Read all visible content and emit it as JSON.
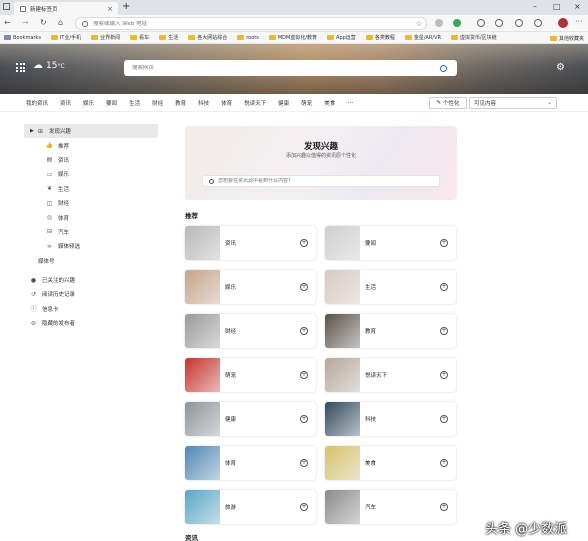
{
  "browser": {
    "tab_title": "新建标签页",
    "url_placeholder": "搜索或输入 Web 地址",
    "bookmarks": [
      "Bookmarks",
      "IT业/手机",
      "业界新闻",
      "看车",
      "生活",
      "各大网站综合",
      "roots",
      "MDM虚拟化/教育",
      "App运营",
      "各类教程",
      "金星/AR/VR",
      "虚拟货币/区块链"
    ],
    "other_bookmarks": "其他收藏夹"
  },
  "hero": {
    "temperature": "15",
    "unit": "°C",
    "search_placeholder": "搜索网页"
  },
  "categories": [
    "我的资讯",
    "资讯",
    "娱乐",
    "要闻",
    "生活",
    "财经",
    "教育",
    "科技",
    "体育",
    "悦读天下",
    "健康",
    "萌宠",
    "美食"
  ],
  "personalize_label": "个性化",
  "visibility_label": "可见内容",
  "sidebar": {
    "main_label": "发现兴趣",
    "sub_items": [
      {
        "label": "推荐",
        "icon": "thumbs-up-icon"
      },
      {
        "label": "资讯",
        "icon": "newspaper-icon"
      },
      {
        "label": "娱乐",
        "icon": "tv-icon"
      },
      {
        "label": "生活",
        "icon": "leaf-icon"
      },
      {
        "label": "财经",
        "icon": "money-icon"
      },
      {
        "label": "体育",
        "icon": "ball-icon"
      },
      {
        "label": "汽车",
        "icon": "car-icon"
      },
      {
        "label": "媒体频选",
        "icon": "link-icon"
      },
      {
        "label": "媒体号",
        "icon": ""
      }
    ],
    "bottom_items": [
      {
        "label": "已关注的兴趣",
        "icon": "check-circle-icon"
      },
      {
        "label": "阅读历史记录",
        "icon": "history-icon"
      },
      {
        "label": "信息卡",
        "icon": "info-icon"
      },
      {
        "label": "隐藏的发布者",
        "icon": "block-icon"
      }
    ]
  },
  "discover": {
    "title": "发现兴趣",
    "subtitle": "添加兴趣以值得的资讯原个性化",
    "search_placeholder": "您想要在资讯源中看到什么内容?"
  },
  "recommend_label": "推荐",
  "next_section_label": "资讯",
  "cards": [
    {
      "label": "资讯",
      "color": "#b9b9b9"
    },
    {
      "label": "要闻",
      "color": "#cfcfcf"
    },
    {
      "label": "娱乐",
      "color": "#c7a38a"
    },
    {
      "label": "生活",
      "color": "#d8c9c2"
    },
    {
      "label": "财经",
      "color": "#9a9a9a"
    },
    {
      "label": "教育",
      "color": "#5a5248"
    },
    {
      "label": "萌宠",
      "color": "#c7332c"
    },
    {
      "label": "悦读天下",
      "color": "#b8a89a"
    },
    {
      "label": "健康",
      "color": "#8d9498"
    },
    {
      "label": "科技",
      "color": "#2f4a5e"
    },
    {
      "label": "体育",
      "color": "#4f88b7"
    },
    {
      "label": "美食",
      "color": "#d7c36a"
    },
    {
      "label": "旅游",
      "color": "#58a8c9"
    },
    {
      "label": "汽车",
      "color": "#8b8b8b"
    }
  ],
  "watermark": "头条 @少数派"
}
